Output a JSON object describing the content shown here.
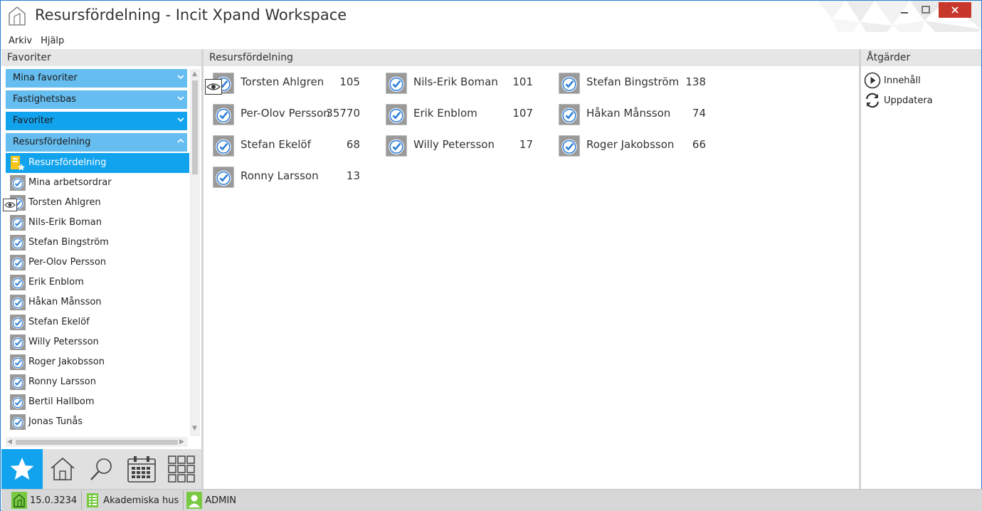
{
  "window": {
    "title": "Resursfördelning - Incit Xpand Workspace"
  },
  "menu": {
    "file": "Arkiv",
    "help": "Hjälp"
  },
  "left_panel": {
    "header": "Favoriter",
    "accordion": [
      {
        "label": "Mina favoriter",
        "state": "collapsed"
      },
      {
        "label": "Fastighetsbas",
        "state": "collapsed"
      },
      {
        "label": "Favoriter",
        "state": "collapsed"
      },
      {
        "label": "Resursfördelning",
        "state": "expanded"
      }
    ],
    "tree": [
      {
        "label": "Resursfördelning",
        "icon": "folder-star-icon",
        "selected": true
      },
      {
        "label": "Mina arbetsordrar",
        "icon": "work-order-check-icon"
      },
      {
        "label": "Torsten Ahlgren",
        "icon": "work-order-check-icon"
      },
      {
        "label": "Nils-Erik Boman",
        "icon": "work-order-check-icon"
      },
      {
        "label": "Stefan Bingström",
        "icon": "work-order-check-icon"
      },
      {
        "label": "Per-Olov Persson",
        "icon": "work-order-check-icon"
      },
      {
        "label": "Erik Enblom",
        "icon": "work-order-check-icon"
      },
      {
        "label": "Håkan Månsson",
        "icon": "work-order-check-icon"
      },
      {
        "label": "Stefan Ekelöf",
        "icon": "work-order-check-icon"
      },
      {
        "label": "Willy Petersson",
        "icon": "work-order-check-icon"
      },
      {
        "label": "Roger Jakobsson",
        "icon": "work-order-check-icon"
      },
      {
        "label": "Ronny Larsson",
        "icon": "work-order-check-icon"
      },
      {
        "label": "Bertil Hallbom",
        "icon": "work-order-check-icon"
      },
      {
        "label": "Jonas Tunås",
        "icon": "work-order-check-icon"
      }
    ]
  },
  "bottom_nav": [
    "star-icon",
    "home-icon",
    "search-icon",
    "calendar-icon",
    "grid-icon"
  ],
  "center": {
    "header": "Resursfördelning",
    "tiles": [
      {
        "name": "Torsten Ahlgren",
        "count": "105"
      },
      {
        "name": "Nils-Erik Boman",
        "count": "101"
      },
      {
        "name": "Stefan Bingström",
        "count": "138"
      },
      {
        "name": "Per-Olov Persson",
        "count": "35770"
      },
      {
        "name": "Erik Enblom",
        "count": "107"
      },
      {
        "name": "Håkan Månsson",
        "count": "74"
      },
      {
        "name": "Stefan Ekelöf",
        "count": "68"
      },
      {
        "name": "Willy Petersson",
        "count": "17"
      },
      {
        "name": "Roger Jakobsson",
        "count": "66"
      },
      {
        "name": "Ronny Larsson",
        "count": "13"
      }
    ]
  },
  "right_panel": {
    "header": "Åtgärder",
    "actions": [
      {
        "label": "Innehåll",
        "icon": "play-circle-icon"
      },
      {
        "label": "Uppdatera",
        "icon": "refresh-icon"
      }
    ]
  },
  "status": {
    "version": "15.0.3234",
    "organization": "Akademiska hus",
    "user": "ADMIN"
  },
  "colors": {
    "accent": "#12a3ee",
    "accordion_light": "#66bdf0",
    "close_button": "#c7372c",
    "status_green": "#7ac943"
  }
}
